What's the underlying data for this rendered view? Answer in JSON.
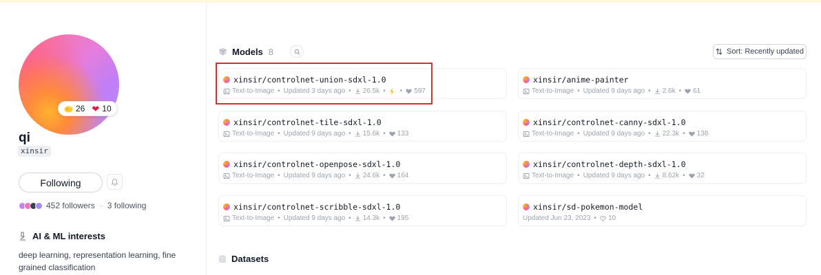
{
  "profile": {
    "avatar_colors": [
      "#ff6f8e",
      "#c07ff7",
      "#ffb22e"
    ],
    "hug_count": "26",
    "heart_count": "10",
    "name": "qi",
    "username": "xinsir",
    "follow_label": "Following",
    "followers_label": "452 followers",
    "following_label": "3 following",
    "interests_title": "AI & ML interests",
    "interests_text": "deep learning, representation learning, fine grained classification"
  },
  "models": {
    "title": "Models",
    "count": "8",
    "sort_label": "Sort:  Recently updated",
    "items": [
      {
        "name": "xinsir/controlnet-union-sdxl-1.0",
        "task": "Text-to-Image",
        "updated": "Updated 3 days ago",
        "downloads": "26.5k",
        "likes": "597",
        "flash": true
      },
      {
        "name": "xinsir/anime-painter",
        "task": "Text-to-Image",
        "updated": "Updated 9 days ago",
        "downloads": "2.6k",
        "likes": "61"
      },
      {
        "name": "xinsir/controlnet-tile-sdxl-1.0",
        "task": "Text-to-Image",
        "updated": "Updated 9 days ago",
        "downloads": "15.6k",
        "likes": "133"
      },
      {
        "name": "xinsir/controlnet-canny-sdxl-1.0",
        "task": "Text-to-Image",
        "updated": "Updated 9 days ago",
        "downloads": "22.3k",
        "likes": "138"
      },
      {
        "name": "xinsir/controlnet-openpose-sdxl-1.0",
        "task": "Text-to-Image",
        "updated": "Updated 9 days ago",
        "downloads": "24.6k",
        "likes": "164"
      },
      {
        "name": "xinsir/controlnet-depth-sdxl-1.0",
        "task": "Text-to-Image",
        "updated": "Updated 9 days ago",
        "downloads": "8.62k",
        "likes": "32"
      },
      {
        "name": "xinsir/controlnet-scribble-sdxl-1.0",
        "task": "Text-to-Image",
        "updated": "Updated 9 days ago",
        "downloads": "14.3k",
        "likes": "195"
      },
      {
        "name": "xinsir/sd-pokemon-model",
        "updated": "Updated Jun 23, 2023",
        "likes": "10"
      }
    ]
  },
  "datasets": {
    "title": "Datasets"
  },
  "colors": {
    "highlight": "#d62d2d",
    "heart": "#e11d48",
    "topbar": "#fdf7dc"
  }
}
